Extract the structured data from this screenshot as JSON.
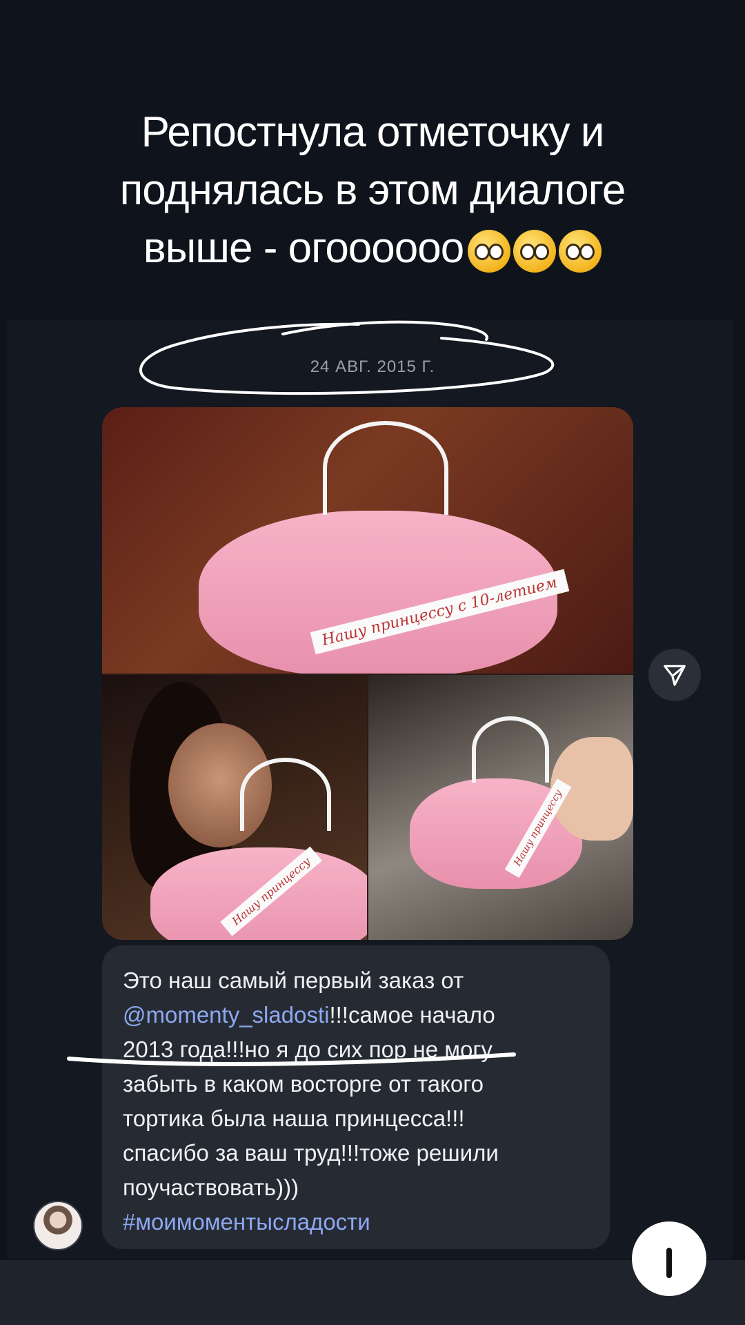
{
  "story": {
    "title_lines": [
      "Репостнула отметочку и",
      "поднялась в этом диалоге",
      "выше - огоооооо"
    ],
    "emoji_icons": [
      "pleading-face-emoji",
      "pleading-face-emoji",
      "pleading-face-emoji"
    ]
  },
  "chat": {
    "date_separator": "24 АВГ. 2015 Г.",
    "photo_caption_top": "Нашу принцессу с 10-летием",
    "photo_caption_bottom_left": "Нашу принцессу",
    "photo_caption_bottom_right": "Нашу принцессу",
    "message": {
      "line1": "Это наш самый первый заказ от",
      "mention": "@momenty_sladosti",
      "line2_rest": "!!!самое начало",
      "line3": "2013 года!!!но я до сих пор не могу",
      "line4": "забыть в каком восторге от такого",
      "line5": "тортика была наша принцесса!!!",
      "line6": "спасибо за ваш труд!!!тоже решили",
      "line7": "поучаствовать)))",
      "hashtag": "#моимоментысладости"
    },
    "share_icon": "paper-plane-icon"
  },
  "colors": {
    "background": "#0f131b",
    "bubble": "#262b33",
    "link": "#8ea8f2"
  }
}
